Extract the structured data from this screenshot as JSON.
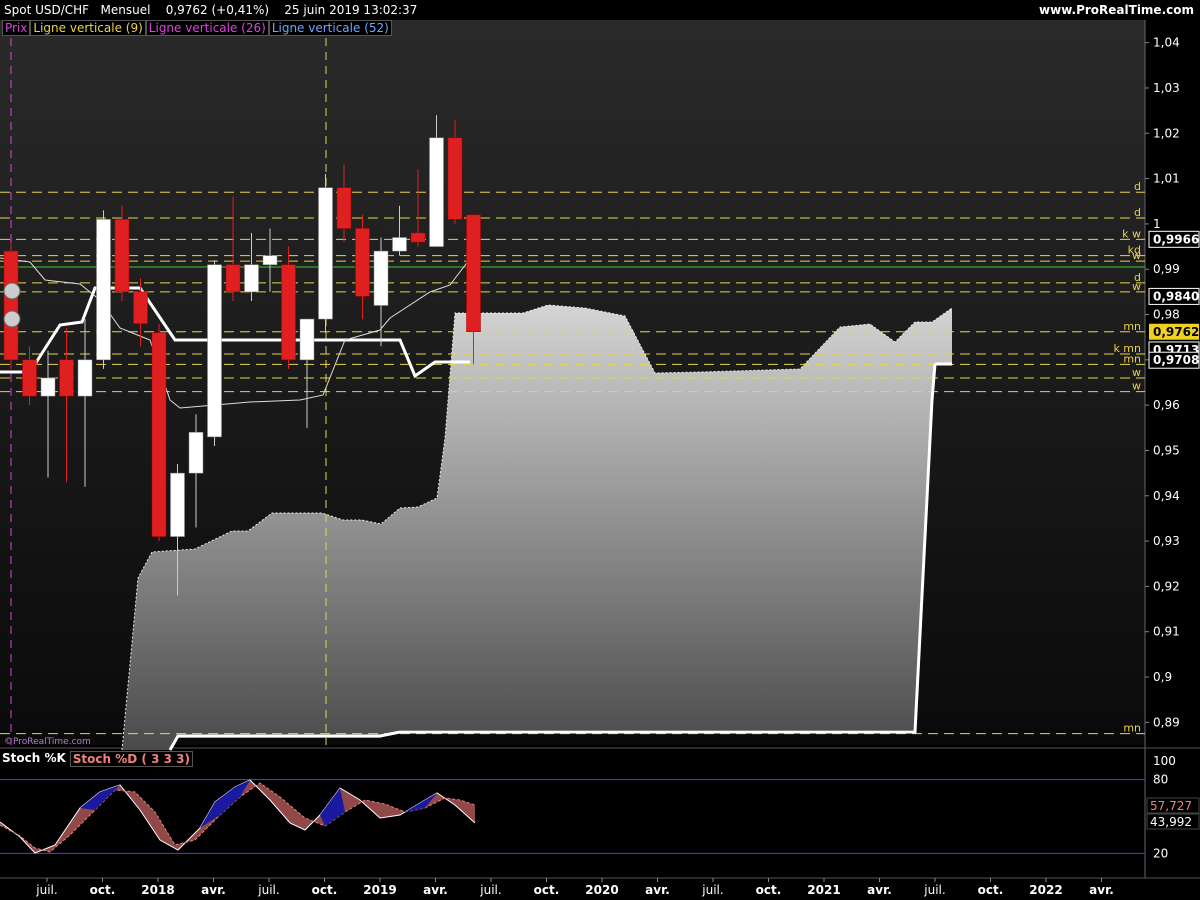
{
  "header": {
    "ticker": "Spot USD/CHF   Mensuel    0,9762 (+0,41%)    25 juin 2019 13:02:37",
    "brand": "www.ProRealTime.com"
  },
  "legend": {
    "prix": "Prix",
    "v9": "Ligne verticale (9)",
    "v26": "Ligne verticale (26)",
    "v52": "Ligne verticale (52)"
  },
  "stoch_legend": {
    "k": "Stoch %K",
    "d": "Stoch %D ( 3 3 3)"
  },
  "watermark": "©ProRealTime.com",
  "colors": {
    "background": "#000000",
    "plot_bg_top": "#2a2a2a",
    "plot_bg_bottom": "#0a0a0a",
    "bull": "#ffffff",
    "bear": "#e02020",
    "cloud": "#cfcfcf",
    "kijun": "#ffffff",
    "levels": "#e8d34a",
    "price_box": "#f0d020",
    "stoch_band": "#4040ff"
  },
  "chart_data": {
    "type": "candlestick",
    "title": "Spot USD/CHF",
    "timeframe": "Mensuel",
    "last_price": "0,9762",
    "change": "(+0,41%)",
    "timestamp": "25 juin 2019 13:02:37",
    "ylim": [
      0.885,
      1.045
    ],
    "yticks": [
      "1,04",
      "1,03",
      "1,02",
      "1,01",
      "1",
      "0,99",
      "0,98",
      "0,97",
      "0,96",
      "0,95",
      "0,94",
      "0,93",
      "0,92",
      "0,91",
      "0,9",
      "0,89"
    ],
    "xticks": [
      "juil.",
      "oct.",
      "2018",
      "avr.",
      "juil.",
      "oct.",
      "2019",
      "avr.",
      "juil.",
      "oct.",
      "2020",
      "avr.",
      "juil.",
      "oct.",
      "2021",
      "avr.",
      "juil.",
      "oct.",
      "2022",
      "avr."
    ],
    "candles": [
      {
        "o": 0.994,
        "h": 0.996,
        "l": 0.968,
        "c": 0.97
      },
      {
        "o": 0.97,
        "h": 0.973,
        "l": 0.96,
        "c": 0.962
      },
      {
        "o": 0.962,
        "h": 0.972,
        "l": 0.944,
        "c": 0.966
      },
      {
        "o": 0.97,
        "h": 0.977,
        "l": 0.943,
        "c": 0.962
      },
      {
        "o": 0.962,
        "h": 0.979,
        "l": 0.942,
        "c": 0.97
      },
      {
        "o": 0.97,
        "h": 1.003,
        "l": 0.968,
        "c": 1.001
      },
      {
        "o": 1.001,
        "h": 1.004,
        "l": 0.983,
        "c": 0.985
      },
      {
        "o": 0.985,
        "h": 0.988,
        "l": 0.973,
        "c": 0.978
      },
      {
        "o": 0.976,
        "h": 0.978,
        "l": 0.93,
        "c": 0.931
      },
      {
        "o": 0.931,
        "h": 0.947,
        "l": 0.918,
        "c": 0.945
      },
      {
        "o": 0.945,
        "h": 0.958,
        "l": 0.933,
        "c": 0.954
      },
      {
        "o": 0.953,
        "h": 0.992,
        "l": 0.951,
        "c": 0.991
      },
      {
        "o": 0.991,
        "h": 1.006,
        "l": 0.983,
        "c": 0.985
      },
      {
        "o": 0.985,
        "h": 0.998,
        "l": 0.983,
        "c": 0.991
      },
      {
        "o": 0.991,
        "h": 0.999,
        "l": 0.985,
        "c": 0.993
      },
      {
        "o": 0.991,
        "h": 0.995,
        "l": 0.968,
        "c": 0.97
      },
      {
        "o": 0.97,
        "h": 0.979,
        "l": 0.955,
        "c": 0.979
      },
      {
        "o": 0.979,
        "h": 1.011,
        "l": 0.976,
        "c": 1.008
      },
      {
        "o": 1.008,
        "h": 1.013,
        "l": 0.996,
        "c": 0.999
      },
      {
        "o": 0.999,
        "h": 1.002,
        "l": 0.979,
        "c": 0.984
      },
      {
        "o": 0.982,
        "h": 0.997,
        "l": 0.973,
        "c": 0.994
      },
      {
        "o": 0.994,
        "h": 1.004,
        "l": 0.993,
        "c": 0.997
      },
      {
        "o": 0.998,
        "h": 1.012,
        "l": 0.995,
        "c": 0.996
      },
      {
        "o": 0.995,
        "h": 1.024,
        "l": 0.995,
        "c": 1.019
      },
      {
        "o": 1.019,
        "h": 1.023,
        "l": 1.0,
        "c": 1.001
      },
      {
        "o": 1.002,
        "h": 1.002,
        "l": 0.969,
        "c": 0.9762
      }
    ],
    "levels": [
      {
        "v": 1.007,
        "label": "d"
      },
      {
        "v": 1.0013,
        "label": "d"
      },
      {
        "v": 0.9966,
        "label": "k w"
      },
      {
        "v": 0.993,
        "label": "kd"
      },
      {
        "v": 0.9918,
        "label": "w"
      },
      {
        "v": 0.987,
        "label": "d"
      },
      {
        "v": 0.985,
        "label": "w"
      },
      {
        "v": 0.9762,
        "label": "mn"
      },
      {
        "v": 0.9713,
        "label": "k mn"
      },
      {
        "v": 0.969,
        "label": "mn"
      },
      {
        "v": 0.966,
        "label": "w"
      },
      {
        "v": 0.963,
        "label": "w"
      },
      {
        "v": 0.8875,
        "label": "mn"
      }
    ],
    "price_labels": [
      "0,9966",
      "0,9840",
      "0,9762",
      "0,9713",
      "0,9708"
    ],
    "stoch": {
      "ylim": [
        0,
        100
      ],
      "yticks": [
        "100",
        "80",
        "20"
      ],
      "k_last": "43,992",
      "d_last": "57,727"
    }
  }
}
